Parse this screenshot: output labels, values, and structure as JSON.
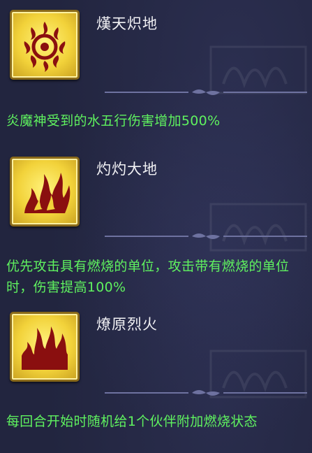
{
  "skills": [
    {
      "name": "熯天炽地",
      "icon": "fire-ring-icon",
      "description": "炎魔神受到的水五行伤害增加500%"
    },
    {
      "name": "灼灼大地",
      "icon": "fire-burst-icon",
      "description": "优先攻击具有燃烧的单位，攻击带有燃烧的单位时，伤害提高100%"
    },
    {
      "name": "燎原烈火",
      "icon": "flames-icon",
      "description": "每回合开始时随机给1个伙伴附加燃烧状态"
    }
  ],
  "colors": {
    "background": "#22253f",
    "description_text": "#5ff25f",
    "name_text": "#f1f1f4",
    "icon_gold": "#f2d23a",
    "flame_red": "#8a0f0f"
  }
}
